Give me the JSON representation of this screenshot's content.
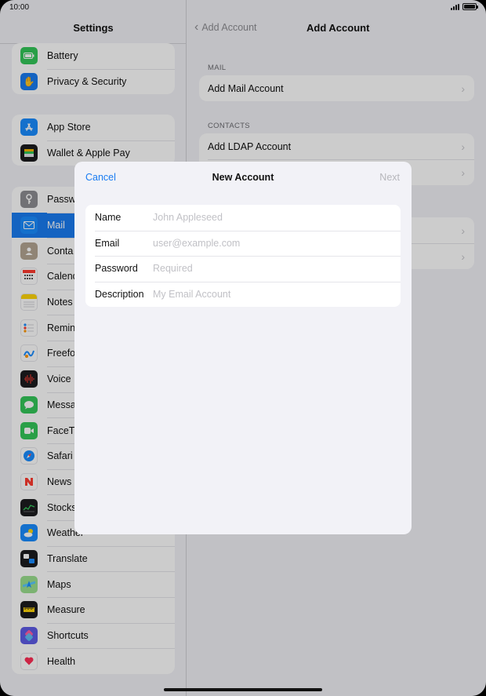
{
  "status": {
    "time": "10:00"
  },
  "sidebar": {
    "title": "Settings",
    "groups": [
      {
        "items": [
          {
            "label": "Battery",
            "icon": "battery-icon",
            "color": "#34c759"
          },
          {
            "label": "Privacy & Security",
            "icon": "hand-icon",
            "color": "#1a7cf2"
          }
        ]
      },
      {
        "items": [
          {
            "label": "App Store",
            "icon": "app-store-icon",
            "color": "#1a8cff"
          },
          {
            "label": "Wallet & Apple Pay",
            "icon": "wallet-icon",
            "color": "#1c1c1e"
          }
        ]
      },
      {
        "items": [
          {
            "label": "Passw",
            "icon": "key-icon",
            "color": "#8e8e93"
          },
          {
            "label": "Mail",
            "icon": "mail-icon",
            "color": "#1a8cff",
            "selected": true
          },
          {
            "label": "Conta",
            "icon": "contacts-icon",
            "color": "#b5a593"
          },
          {
            "label": "Calend",
            "icon": "calendar-icon",
            "color": "#ffffff"
          },
          {
            "label": "Notes",
            "icon": "notes-icon",
            "color": "#ffd60a"
          },
          {
            "label": "Remin",
            "icon": "reminders-icon",
            "color": "#ffffff"
          },
          {
            "label": "Freefo",
            "icon": "freeform-icon",
            "color": "#ffffff"
          },
          {
            "label": "Voice",
            "icon": "voice-memos-icon",
            "color": "#1c1c1e"
          },
          {
            "label": "Messa",
            "icon": "messages-icon",
            "color": "#34c759"
          },
          {
            "label": "FaceTi",
            "icon": "facetime-icon",
            "color": "#34c759"
          },
          {
            "label": "Safari",
            "icon": "safari-icon",
            "color": "#ffffff"
          },
          {
            "label": "News",
            "icon": "news-icon",
            "color": "#ffffff"
          },
          {
            "label": "Stocks",
            "icon": "stocks-icon",
            "color": "#1c1c1e"
          },
          {
            "label": "Weather",
            "icon": "weather-icon",
            "color": "#1a8cff"
          },
          {
            "label": "Translate",
            "icon": "translate-icon",
            "color": "#1c1c1e"
          },
          {
            "label": "Maps",
            "icon": "maps-icon",
            "color": "#5ac8fa"
          },
          {
            "label": "Measure",
            "icon": "measure-icon",
            "color": "#1c1c1e"
          },
          {
            "label": "Shortcuts",
            "icon": "shortcuts-icon",
            "color": "#5e5ce6"
          },
          {
            "label": "Health",
            "icon": "health-icon",
            "color": "#ffffff"
          }
        ]
      }
    ]
  },
  "detail": {
    "back_label": "Add Account",
    "title": "Add Account",
    "sections": [
      {
        "header": "MAIL",
        "rows": [
          "Add Mail Account"
        ]
      },
      {
        "header": "CONTACTS",
        "rows": [
          "Add LDAP Account",
          ""
        ]
      },
      {
        "header": "",
        "rows": [
          "",
          ""
        ]
      }
    ]
  },
  "modal": {
    "cancel": "Cancel",
    "title": "New Account",
    "next": "Next",
    "fields": [
      {
        "label": "Name",
        "placeholder": "John Appleseed"
      },
      {
        "label": "Email",
        "placeholder": "user@example.com"
      },
      {
        "label": "Password",
        "placeholder": "Required"
      },
      {
        "label": "Description",
        "placeholder": "My Email Account"
      }
    ]
  }
}
